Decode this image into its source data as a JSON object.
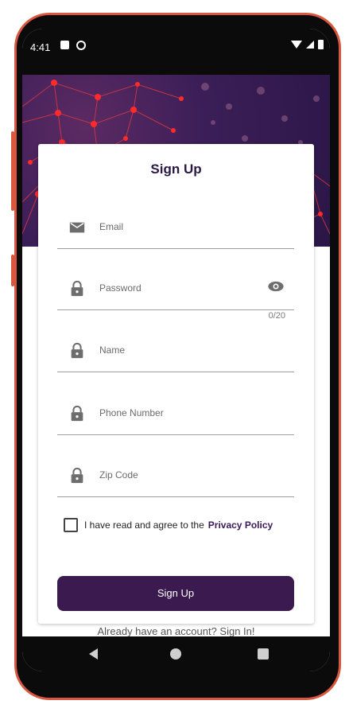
{
  "status_bar": {
    "time": "4:41"
  },
  "form": {
    "title": "Sign Up",
    "fields": [
      {
        "label": "Email",
        "icon": "email-icon"
      },
      {
        "label": "Password",
        "icon": "lock-icon",
        "counter": "0/20"
      },
      {
        "label": "Name",
        "icon": "lock-icon"
      },
      {
        "label": "Phone Number",
        "icon": "lock-icon"
      },
      {
        "label": "Zip Code",
        "icon": "lock-icon"
      }
    ],
    "agreement_text": "I have read and agree to the",
    "privacy_policy_link": "Privacy Policy",
    "submit_label": "Sign Up",
    "signin_text": "Already have an account? Sign In!"
  },
  "colors": {
    "primary": "#3a1a4f",
    "frame": "#d9573f",
    "banner": "#3b1e57",
    "nodes": "#ff2a2a"
  }
}
